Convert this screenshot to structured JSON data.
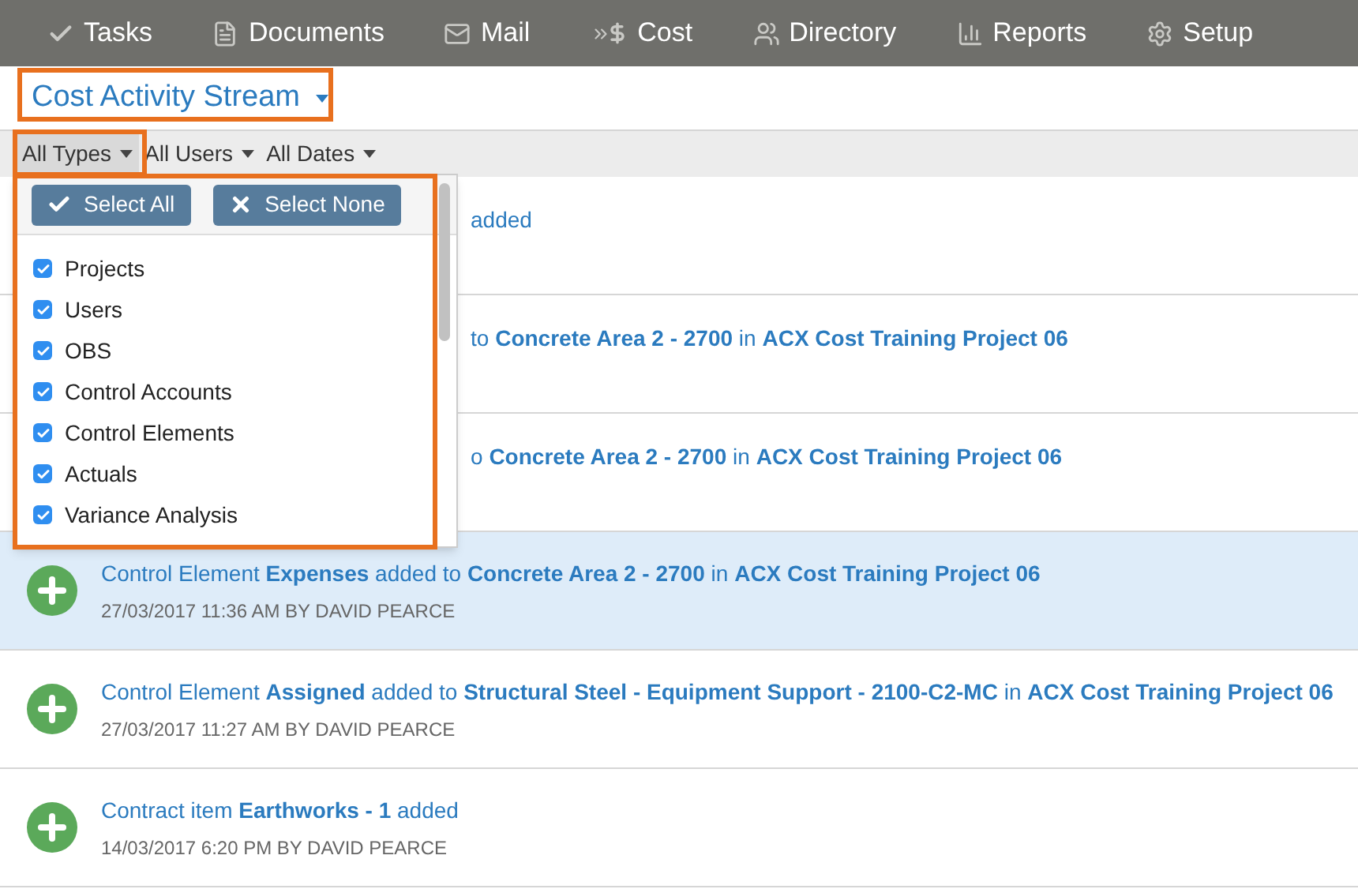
{
  "nav": [
    {
      "kind": "check",
      "label": "Tasks"
    },
    {
      "kind": "document",
      "label": "Documents"
    },
    {
      "kind": "mail",
      "label": "Mail"
    },
    {
      "kind": "cost",
      "label": "Cost"
    },
    {
      "kind": "people",
      "label": "Directory"
    },
    {
      "kind": "chart",
      "label": "Reports"
    },
    {
      "kind": "gear",
      "label": "Setup"
    }
  ],
  "title": "Cost Activity Stream",
  "filters": [
    {
      "label": "All Types",
      "selected": true
    },
    {
      "label": "All Users",
      "selected": false
    },
    {
      "label": "All Dates",
      "selected": false
    }
  ],
  "type_menu": {
    "buttons": [
      {
        "kind": "check",
        "label": "Select All"
      },
      {
        "kind": "cross",
        "label": "Select None"
      }
    ],
    "items": [
      {
        "label": "Projects",
        "checked": true
      },
      {
        "label": "Users",
        "checked": true
      },
      {
        "label": "OBS",
        "checked": true
      },
      {
        "label": "Control Accounts",
        "checked": true
      },
      {
        "label": "Control Elements",
        "checked": true
      },
      {
        "label": "Actuals",
        "checked": true
      },
      {
        "label": "Variance Analysis",
        "checked": true
      }
    ]
  },
  "activities": [
    {
      "kind": "covered",
      "message": "added",
      "selected": false
    },
    {
      "kind": "covered",
      "message": "to **Concrete Area 2 - 2700** in **ACX Cost Training Project 06**",
      "selected": false
    },
    {
      "kind": "covered",
      "message": "o **Concrete Area 2 - 2700** in **ACX Cost Training Project 06**",
      "selected": false
    },
    {
      "kind": "full",
      "message": "Control Element **Expenses** added to **Concrete Area 2 - 2700** in **ACX Cost Training Project 06**",
      "meta": "27/03/2017 11:36 AM BY DAVID PEARCE",
      "selected": true
    },
    {
      "kind": "full",
      "message": "Control Element **Assigned** added to **Structural Steel - Equipment Support - 2100-C2-MC** in **ACX Cost Training Project 06**",
      "meta": "27/03/2017 11:27 AM BY DAVID PEARCE",
      "selected": false
    },
    {
      "kind": "full",
      "message": "Contract item **Earthworks - 1** added",
      "meta": "14/03/2017 6:20 PM BY DAVID PEARCE",
      "selected": false
    }
  ]
}
